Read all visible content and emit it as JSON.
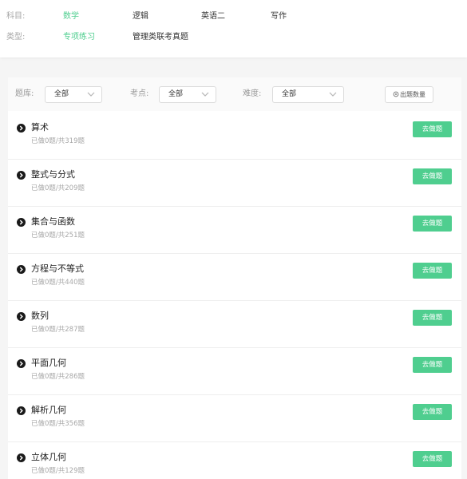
{
  "filters": {
    "subject": {
      "label": "科目:",
      "options": [
        "数学",
        "逻辑",
        "英语二",
        "写作"
      ],
      "active": "数学"
    },
    "type": {
      "label": "类型:",
      "options": [
        "专项练习",
        "管理类联考真题"
      ],
      "active": "专项练习"
    }
  },
  "toolbar": {
    "bank": {
      "label": "题库:",
      "value": "全部"
    },
    "point": {
      "label": "考点:",
      "value": "全部"
    },
    "difficulty": {
      "label": "难度:",
      "value": "全部"
    },
    "count_button": "出题数量"
  },
  "items": [
    {
      "title": "算术",
      "progress": "已做0题/共319题",
      "action": "去做题"
    },
    {
      "title": "整式与分式",
      "progress": "已做0题/共209题",
      "action": "去做题"
    },
    {
      "title": "集合与函数",
      "progress": "已做0题/共251题",
      "action": "去做题"
    },
    {
      "title": "方程与不等式",
      "progress": "已做0题/共440题",
      "action": "去做题"
    },
    {
      "title": "数列",
      "progress": "已做0题/共287题",
      "action": "去做题"
    },
    {
      "title": "平面几何",
      "progress": "已做0题/共286题",
      "action": "去做题"
    },
    {
      "title": "解析几何",
      "progress": "已做0题/共356题",
      "action": "去做题"
    },
    {
      "title": "立体几何",
      "progress": "已做0题/共129题",
      "action": "去做题"
    }
  ],
  "colors": {
    "accent": "#4fce8f",
    "bullet": "#1a1a1a"
  }
}
